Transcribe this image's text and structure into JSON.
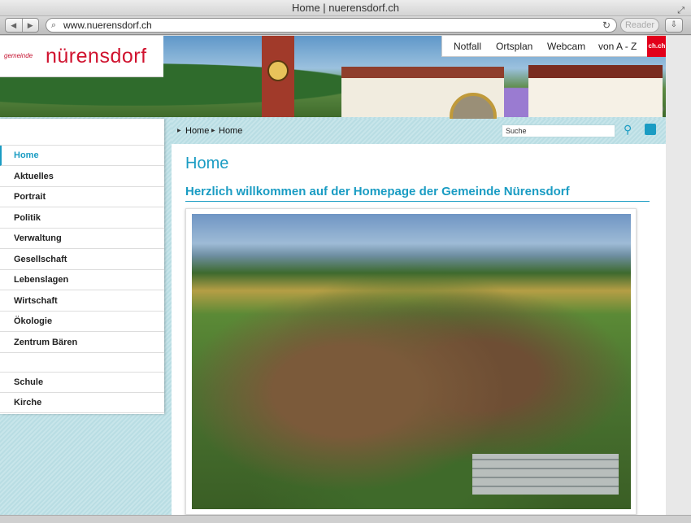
{
  "browser": {
    "window_title": "Home | nuerensdorf.ch",
    "url": "www.nuerensdorf.ch",
    "reader_label": "Reader",
    "back_glyph": "◀",
    "forward_glyph": "▶",
    "search_glyph": "⌕",
    "reload_glyph": "↻",
    "download_glyph": "⇩",
    "resize_glyph": "⤢"
  },
  "site": {
    "logo_small": "gemeinde",
    "logo_main": "nürensdorf",
    "top_nav": [
      "Notfall",
      "Ortsplan",
      "Webcam",
      "von A - Z"
    ],
    "ch_badge": "ch.ch"
  },
  "sidebar": {
    "items": [
      {
        "label": "Home",
        "active": true
      },
      {
        "label": "Aktuelles"
      },
      {
        "label": "Portrait"
      },
      {
        "label": "Politik"
      },
      {
        "label": "Verwaltung"
      },
      {
        "label": "Gesellschaft"
      },
      {
        "label": "Lebenslagen"
      },
      {
        "label": "Wirtschaft"
      },
      {
        "label": "Ökologie"
      },
      {
        "label": "Zentrum Bären"
      }
    ],
    "secondary": [
      {
        "label": "Schule"
      },
      {
        "label": "Kirche"
      }
    ]
  },
  "content": {
    "breadcrumb": [
      "Home",
      "Home"
    ],
    "breadcrumb_sep": "▶",
    "search_value": "Suche",
    "search_icon_glyph": "⚲",
    "page_title": "Home",
    "heading": "Herzlich willkommen auf der Homepage der Gemeinde Nürensdorf"
  },
  "colors": {
    "accent": "#1a9cc3",
    "brand_red": "#d0132f"
  }
}
